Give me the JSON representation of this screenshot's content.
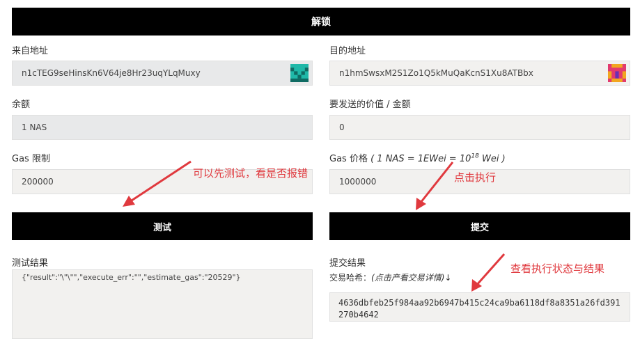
{
  "header": {
    "title": "解锁"
  },
  "from": {
    "label": "来自地址",
    "value": "n1cTEG9seHinsKn6V64je8Hr23uqYLqMuxy",
    "identicon_colors": [
      "#1fb8a8",
      "#0f6b63"
    ]
  },
  "to": {
    "label": "目的地址",
    "value": "n1hmSwsxM2S1Zo1Q5kMuQaKcnS1Xu8ATBbx",
    "identicon_colors": [
      "#e23a6e",
      "#f2a61f"
    ]
  },
  "balance": {
    "label": "余额",
    "value": "1 NAS"
  },
  "amount": {
    "label": "要发送的价值 / 金额",
    "value": "0"
  },
  "gas_limit": {
    "label": "Gas 限制",
    "value": "200000"
  },
  "gas_price": {
    "label_prefix": "Gas 价格",
    "label_unit": "( 1 NAS = 1EWei = 10",
    "label_exp": "18",
    "label_suffix": "Wei )",
    "value": "1000000"
  },
  "buttons": {
    "test": "测试",
    "submit": "提交"
  },
  "test_result": {
    "label": "测试结果",
    "value": "{\"result\":\"\\\"\\\"\",\"execute_err\":\"\",\"estimate_gas\":\"20529\"}"
  },
  "submit_result": {
    "label": "提交结果",
    "hash_label": "交易哈希：",
    "hash_hint": "(点击产看交易详情)↓",
    "hash_value": "4636dbfeb25f984aa92b6947b415c24ca9ba6118df8a8351a26fd391270b4642"
  },
  "annotations": {
    "test_hint": "可以先测试，看是否报错",
    "submit_hint": "点击执行",
    "status_hint": "查看执行状态与结果",
    "color": "#e0393e"
  }
}
